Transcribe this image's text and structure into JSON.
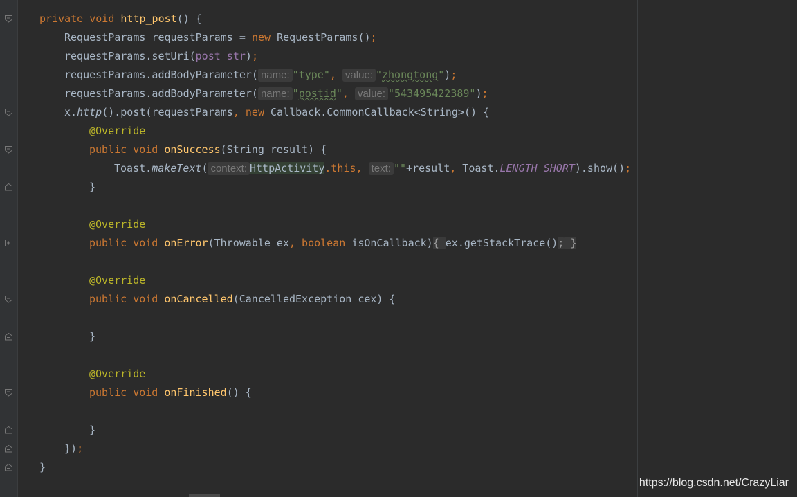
{
  "editor": {
    "lines": [
      {
        "indent": 0,
        "tokens": [
          [
            "kw",
            "private "
          ],
          [
            "kw",
            "void "
          ],
          [
            "fn",
            "http_post"
          ],
          [
            "p",
            "() {"
          ]
        ]
      },
      {
        "indent": 1,
        "tokens": [
          [
            "p",
            "RequestParams requestParams = "
          ],
          [
            "kw",
            "new "
          ],
          [
            "p",
            "RequestParams()"
          ],
          [
            "kw",
            ";"
          ]
        ]
      },
      {
        "indent": 1,
        "tokens": [
          [
            "p",
            "requestParams.setUri("
          ],
          [
            "field",
            "post_str"
          ],
          [
            "p",
            ")"
          ],
          [
            "kw",
            ";"
          ]
        ]
      },
      {
        "indent": 1,
        "tokens": [
          [
            "p",
            "requestParams.addBodyParameter("
          ],
          [
            "hint",
            "name:"
          ],
          [
            "str",
            "\"type\""
          ],
          [
            "kw",
            ", "
          ],
          [
            "hint",
            "value:"
          ],
          [
            "str",
            "\""
          ],
          [
            "typo",
            "zhongtong"
          ],
          [
            "str",
            "\""
          ],
          [
            "p",
            ")"
          ],
          [
            "kw",
            ";"
          ]
        ]
      },
      {
        "indent": 1,
        "tokens": [
          [
            "p",
            "requestParams.addBodyParameter("
          ],
          [
            "hint",
            "name:"
          ],
          [
            "str",
            "\""
          ],
          [
            "typo",
            "postid"
          ],
          [
            "str",
            "\""
          ],
          [
            "kw",
            ", "
          ],
          [
            "hint",
            "value:"
          ],
          [
            "str",
            "\"543495422389\""
          ],
          [
            "p",
            ")"
          ],
          [
            "kw",
            ";"
          ]
        ]
      },
      {
        "indent": 1,
        "tokens": [
          [
            "p",
            "x."
          ],
          [
            "sm",
            "http"
          ],
          [
            "p",
            "().post(requestParams"
          ],
          [
            "kw",
            ", new "
          ],
          [
            "p",
            "Callback.CommonCallback<String>() {"
          ]
        ]
      },
      {
        "indent": 2,
        "tokens": [
          [
            "ann",
            "@Override"
          ]
        ]
      },
      {
        "indent": 2,
        "tokens": [
          [
            "kw",
            "public "
          ],
          [
            "kw",
            "void "
          ],
          [
            "fn",
            "onSuccess"
          ],
          [
            "p",
            "(String result) {"
          ]
        ]
      },
      {
        "indent": 3,
        "tokens": [
          [
            "p",
            "Toast."
          ],
          [
            "sm",
            "makeText"
          ],
          [
            "p",
            "("
          ],
          [
            "hint",
            "context:"
          ],
          [
            "hl",
            "HttpActivity"
          ],
          [
            "kw",
            ".this, "
          ],
          [
            "hint",
            "text:"
          ],
          [
            "str",
            "\"\""
          ],
          [
            "p",
            "+result"
          ],
          [
            "kw",
            ", "
          ],
          [
            "p",
            "Toast."
          ],
          [
            "sf",
            "LENGTH_SHORT"
          ],
          [
            "p",
            ").show()"
          ],
          [
            "kw",
            ";"
          ]
        ]
      },
      {
        "indent": 2,
        "tokens": [
          [
            "p",
            "}"
          ]
        ]
      },
      {
        "indent": 0,
        "tokens": []
      },
      {
        "indent": 2,
        "tokens": [
          [
            "ann",
            "@Override"
          ]
        ]
      },
      {
        "indent": 2,
        "tokens": [
          [
            "kw",
            "public "
          ],
          [
            "kw",
            "void "
          ],
          [
            "fn",
            "onError"
          ],
          [
            "p",
            "(Throwable ex"
          ],
          [
            "kw",
            ", boolean "
          ],
          [
            "p",
            "isOnCallback)"
          ],
          [
            "fb",
            "{ "
          ],
          [
            "p",
            "ex.getStackTrace()"
          ],
          [
            "fb",
            ";"
          ],
          [
            "fb",
            " }"
          ]
        ]
      },
      {
        "indent": 0,
        "tokens": []
      },
      {
        "indent": 2,
        "tokens": [
          [
            "ann",
            "@Override"
          ]
        ]
      },
      {
        "indent": 2,
        "tokens": [
          [
            "kw",
            "public "
          ],
          [
            "kw",
            "void "
          ],
          [
            "fn",
            "onCancelled"
          ],
          [
            "p",
            "(CancelledException cex) {"
          ]
        ]
      },
      {
        "indent": 0,
        "tokens": []
      },
      {
        "indent": 2,
        "tokens": [
          [
            "p",
            "}"
          ]
        ]
      },
      {
        "indent": 0,
        "tokens": []
      },
      {
        "indent": 2,
        "tokens": [
          [
            "ann",
            "@Override"
          ]
        ]
      },
      {
        "indent": 2,
        "tokens": [
          [
            "kw",
            "public "
          ],
          [
            "kw",
            "void "
          ],
          [
            "fn",
            "onFinished"
          ],
          [
            "p",
            "() {"
          ]
        ]
      },
      {
        "indent": 0,
        "tokens": []
      },
      {
        "indent": 2,
        "tokens": [
          [
            "p",
            "}"
          ]
        ]
      },
      {
        "indent": 1,
        "tokens": [
          [
            "p",
            "})"
          ],
          [
            "kw",
            ";"
          ]
        ]
      },
      {
        "indent": 0,
        "tokens": [
          [
            "p",
            "}"
          ]
        ]
      }
    ],
    "fold_markers": [
      {
        "line": 0,
        "kind": "open"
      },
      {
        "line": 5,
        "kind": "open"
      },
      {
        "line": 7,
        "kind": "open"
      },
      {
        "line": 9,
        "kind": "close"
      },
      {
        "line": 12,
        "kind": "collapsed"
      },
      {
        "line": 15,
        "kind": "open"
      },
      {
        "line": 17,
        "kind": "close"
      },
      {
        "line": 20,
        "kind": "open"
      },
      {
        "line": 22,
        "kind": "close"
      },
      {
        "line": 23,
        "kind": "close"
      },
      {
        "line": 24,
        "kind": "close"
      }
    ]
  },
  "watermark": "https://blog.csdn.net/CrazyLiar",
  "colors": {
    "background": "#2b2b2b",
    "keyword": "#cc7832",
    "method_decl": "#ffc66d",
    "string": "#6a8759",
    "annotation": "#bbb529",
    "field": "#9876aa",
    "default_text": "#a9b7c6"
  }
}
